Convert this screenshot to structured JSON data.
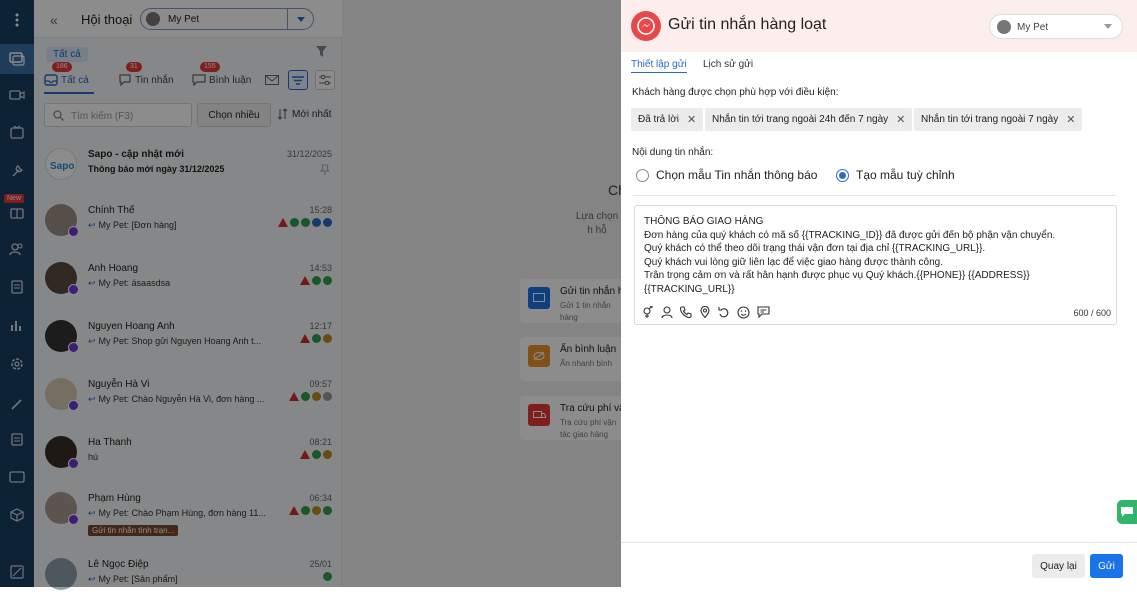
{
  "app": {
    "header_title": "Hội thoại",
    "page_name": "My Pet"
  },
  "filters": {
    "all_label": "Tất cả",
    "tabs": [
      {
        "label": "Tất cả",
        "badge": "186"
      },
      {
        "label": "Tin nhắn",
        "badge": "31"
      },
      {
        "label": "Bình luận",
        "badge": "155"
      }
    ]
  },
  "search": {
    "placeholder": "Tìm kiếm (F3)",
    "multi_select": "Chọn nhiều",
    "sort": "Mới nhất"
  },
  "conversations": [
    {
      "name": "Sapo - cập nhật mới",
      "time": "31/12/2025",
      "preview": "Thông báo mới ngày 31/12/2025"
    },
    {
      "name": "Chính Thế",
      "time": "15:28",
      "preview": "My Pet: [Đơn hàng]"
    },
    {
      "name": "Anh Hoang",
      "time": "14:53",
      "preview": "My Pet: ásaasdsa"
    },
    {
      "name": "Nguyen Hoang Anh",
      "time": "12:17",
      "preview": "My Pet: Shop gửi Nguyen Hoang Anh t..."
    },
    {
      "name": "Nguyễn Hà Vi",
      "time": "09:57",
      "preview": "My Pet: Chào Nguyễn Hà Vi, đơn hàng ..."
    },
    {
      "name": "Ha Thanh",
      "time": "08:21",
      "preview": "hú"
    },
    {
      "name": "Phạm Hùng",
      "time": "06:34",
      "preview": "My Pet: Chào Phạm Hùng, đơn hàng 11...",
      "tag": "Gửi tin nhắn tình trạn..."
    },
    {
      "name": "Lê Ngọc Điệp",
      "time": "25/01",
      "preview": "My Pet: [Sản phẩm]"
    }
  ],
  "middle": {
    "heading": "Ch",
    "subtitle": "Lựa chọn h hỗ",
    "cards": [
      {
        "title": "Gửi tin nhắn h",
        "desc": "Gửi 1 tin nhắn hàng"
      },
      {
        "title": "Ẩn bình luận",
        "desc": "Ẩn nhanh bình"
      },
      {
        "title": "Tra cứu phí vậ",
        "desc": "Tra cứu phí vận tác giao hàng"
      }
    ]
  },
  "modal": {
    "title": "Gửi tin nhắn hàng loạt",
    "page_name": "My Pet",
    "tabs": [
      "Thiết lập gửi",
      "Lịch sử gửi"
    ],
    "conditions_label": "Khách hàng được chọn phù hợp với điều kiện:",
    "conditions": [
      "Đã trả lời",
      "Nhắn tin tới trang ngoài 24h đến 7 ngày",
      "Nhắn tin tới trang ngoài 7 ngày"
    ],
    "content_label": "Nội dung tin nhắn:",
    "options": [
      "Chọn mẫu Tin nhắn thông báo",
      "Tạo mẫu tuỳ chỉnh"
    ],
    "selected_option": 1,
    "message_lines": [
      "THÔNG BÁO GIAO HÀNG",
      "Đơn hàng của quý khách có mã số {{TRACKING_ID}} đã được gửi đến bộ phận vận chuyển.",
      "Quý khách có thể theo dõi trạng thái vận đơn tại địa chỉ {{TRACKING_URL}}.",
      "Quý khách vui lòng giữ liên lạc để việc giao hàng được thành công.",
      "Trân trọng cảm ơn và rất hân hạnh được phục vụ Quý khách.{{PHONE}} {{ADDRESS}}",
      "{{TRACKING_URL}}"
    ],
    "char_count": "600 / 600",
    "back_button": "Quay lại",
    "send_button": "Gửi"
  },
  "colors": {
    "rail": "#1b3f63",
    "accent": "#1a73e8",
    "danger": "#e53935",
    "modal_header": "#fdeeee"
  }
}
